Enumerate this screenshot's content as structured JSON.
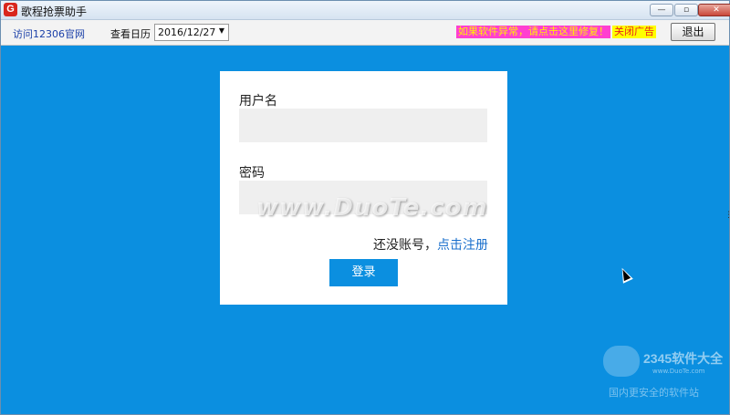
{
  "window": {
    "title": "歌程抢票助手",
    "app_icon_letter": "G",
    "controls": {
      "minimize": "—",
      "restore": "▫",
      "close": "✕"
    }
  },
  "toolbar": {
    "visit_link": "访问12306官网",
    "calendar_label": "查看日历",
    "calendar_date": "2016/12/27",
    "fix_link": "如果软件异常，请点击这里修复！",
    "close_ad": "关闭广告",
    "exit_button": "退出"
  },
  "login": {
    "username_label": "用户名",
    "username_value": "",
    "password_label": "密码",
    "password_value": "",
    "no_account_text": "还没账号，",
    "register_link": "点击注册",
    "login_button": "登录"
  },
  "overlay": {
    "watermark": "www.DuoTe.com",
    "corner_brand": "2345软件大全",
    "corner_url": "www.DuoTe.com",
    "corner_slogan": "国内更安全的软件站"
  },
  "colors": {
    "background": "#0b8fe0",
    "panel": "#ffffff",
    "field": "#efefef",
    "login_button": "#0b8fe0",
    "link": "#1a6fcc",
    "fix_bg": "#ff3fd0",
    "ad_bg": "#ffff00"
  }
}
